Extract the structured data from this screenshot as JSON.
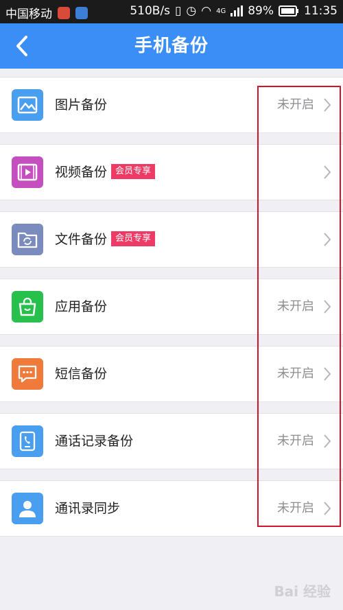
{
  "status_bar": {
    "carrier": "中国移动",
    "speed": "510B/s",
    "network": "4G",
    "battery": "89%",
    "time": "11:35"
  },
  "header": {
    "title": "手机备份",
    "back_icon": "chevron-left-icon"
  },
  "items": [
    {
      "label": "图片备份",
      "badge": "",
      "status": "未开启",
      "icon": "image-icon",
      "color": "#4a9ef0"
    },
    {
      "label": "视频备份",
      "badge": "会员专享",
      "status": "",
      "icon": "video-icon",
      "color": "#c64fc0"
    },
    {
      "label": "文件备份",
      "badge": "会员专享",
      "status": "",
      "icon": "folder-sync-icon",
      "color": "#7b8bbd"
    },
    {
      "label": "应用备份",
      "badge": "",
      "status": "未开启",
      "icon": "shopping-bag-icon",
      "color": "#27c04d"
    },
    {
      "label": "短信备份",
      "badge": "",
      "status": "未开启",
      "icon": "message-icon",
      "color": "#f07a3c"
    },
    {
      "label": "通话记录备份",
      "badge": "",
      "status": "未开启",
      "icon": "call-log-icon",
      "color": "#4a9ef0"
    },
    {
      "label": "通讯录同步",
      "badge": "",
      "status": "未开启",
      "icon": "contact-icon",
      "color": "#4a9ef0"
    }
  ],
  "colors": {
    "header_bg": "#3a8ef5",
    "badge_bg": "#ee3b66",
    "highlight_border": "#d0152b"
  }
}
